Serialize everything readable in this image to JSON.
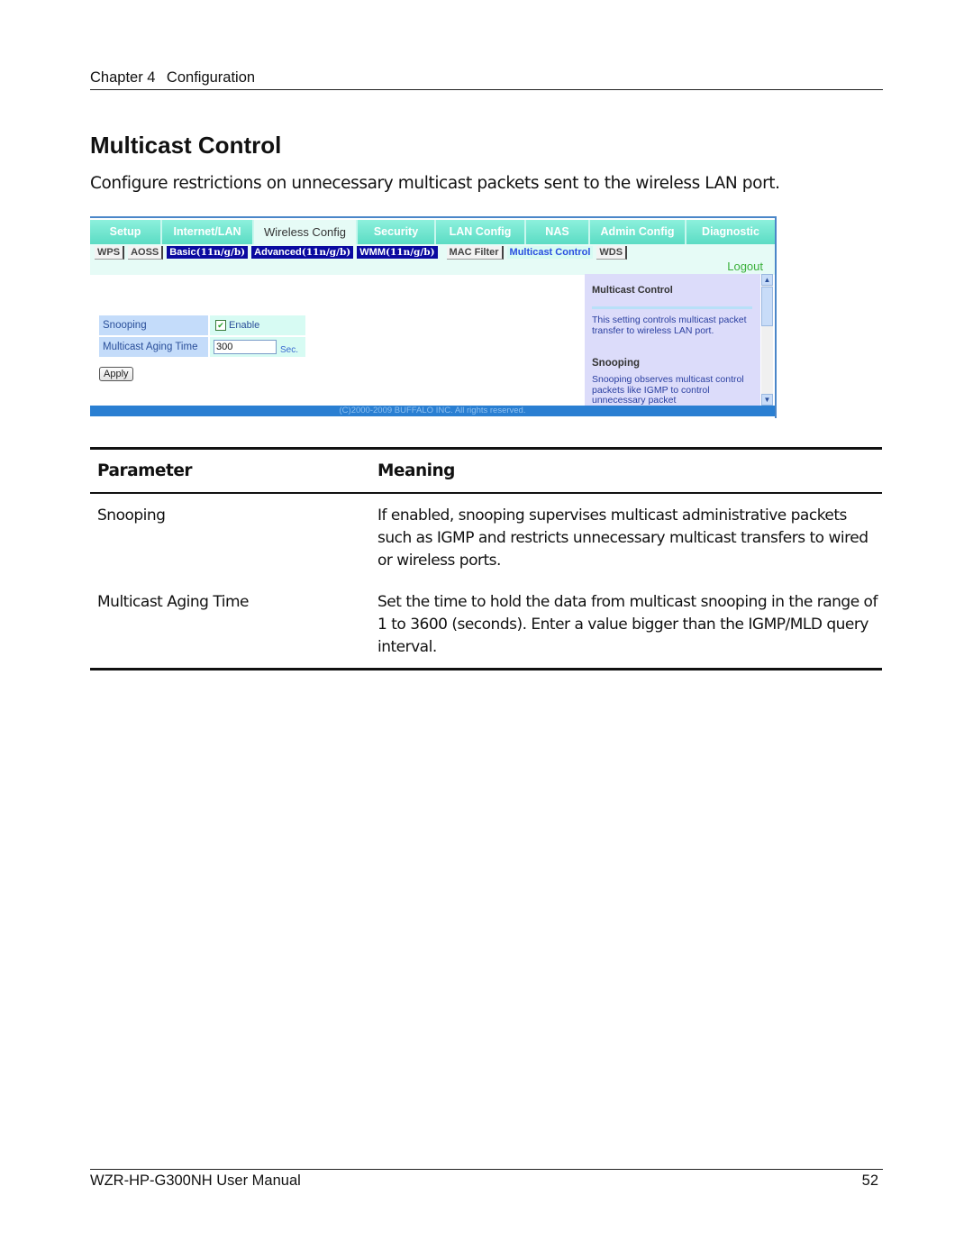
{
  "header": {
    "chapter": "Chapter 4",
    "chapter_title": "Configuration"
  },
  "section": {
    "title": "Multicast Control",
    "intro": "Configure restrictions on unnecessary multicast packets sent to the wireless LAN port."
  },
  "router_ui": {
    "top_tabs": [
      {
        "label": "Setup"
      },
      {
        "label": "Internet/LAN"
      },
      {
        "label": "Wireless Config",
        "active": true
      },
      {
        "label": "Security"
      },
      {
        "label": "LAN Config"
      },
      {
        "label": "NAS"
      },
      {
        "label": "Admin Config"
      },
      {
        "label": "Diagnostic"
      }
    ],
    "sub_tabs": [
      {
        "label": "WPS"
      },
      {
        "label": "AOSS"
      },
      {
        "label": "Basic",
        "suffix": "(11n/g/b)"
      },
      {
        "label": "Advanced",
        "suffix": "(11n/g/b)"
      },
      {
        "label": "WMM",
        "suffix": "(11n/g/b)"
      },
      {
        "label": "MAC Filter"
      },
      {
        "label": "Multicast Control",
        "active": true
      },
      {
        "label": "WDS"
      }
    ],
    "logout": "Logout",
    "form": {
      "snooping_label": "Snooping",
      "snooping_checkbox_label": "Enable",
      "snooping_checked": true,
      "aging_label": "Multicast Aging Time",
      "aging_value": "300",
      "aging_unit": "Sec.",
      "apply_button": "Apply"
    },
    "help": {
      "title": "Multicast Control",
      "text": "This setting controls multicast packet transfer to wireless LAN port.",
      "subtitle": "Snooping",
      "subtext": "Snooping observes multicast control packets like IGMP to control unnecessary packet"
    },
    "copyright": "(C)2000-2009 BUFFALO INC. All rights reserved."
  },
  "table": {
    "headers": [
      "Parameter",
      "Meaning"
    ],
    "rows": [
      {
        "parameter": "Snooping",
        "meaning": "If enabled, snooping supervises multicast administrative packets such as IGMP and restricts unnecessary multicast transfers to wired or wireless ports."
      },
      {
        "parameter": "Multicast Aging Time",
        "meaning": "Set the time to hold the data from multicast snooping in the range of 1 to 3600 (seconds).  Enter a value bigger than the IGMP/MLD query interval."
      }
    ]
  },
  "footer": {
    "manual": "WZR-HP-G300NH User Manual",
    "page": "52"
  }
}
